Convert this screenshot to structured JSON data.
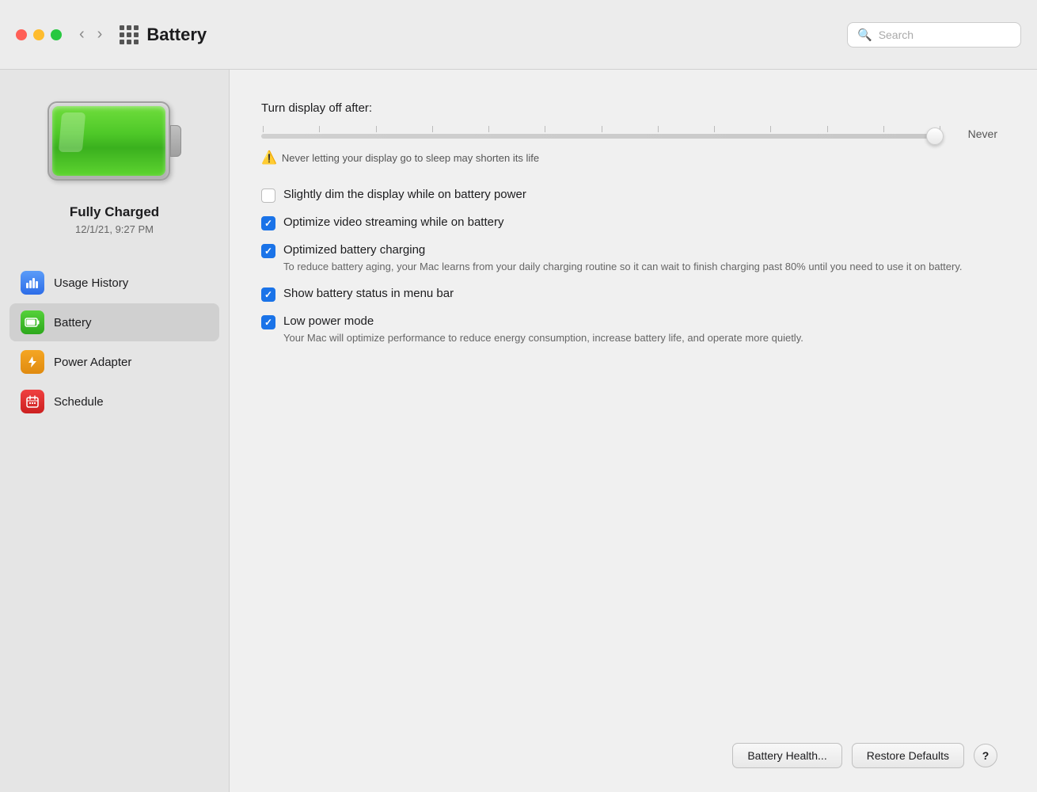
{
  "titlebar": {
    "title": "Battery",
    "search_placeholder": "Search",
    "back_icon": "‹",
    "forward_icon": "›"
  },
  "sidebar": {
    "battery_status": "Fully Charged",
    "battery_time": "12/1/21, 9:27 PM",
    "nav_items": [
      {
        "id": "usage-history",
        "label": "Usage History",
        "icon": "📊",
        "icon_class": "icon-usage",
        "active": false
      },
      {
        "id": "battery",
        "label": "Battery",
        "icon": "🔋",
        "icon_class": "icon-battery",
        "active": true
      },
      {
        "id": "power-adapter",
        "label": "Power Adapter",
        "icon": "⚡",
        "icon_class": "icon-power",
        "active": false
      },
      {
        "id": "schedule",
        "label": "Schedule",
        "icon": "📅",
        "icon_class": "icon-schedule",
        "active": false
      }
    ]
  },
  "settings": {
    "slider_label": "Turn display off after:",
    "slider_value": "Never",
    "slider_warning": "Never letting your display go to sleep may shorten its life",
    "checkboxes": [
      {
        "id": "dim-display",
        "label": "Slightly dim the display while on battery power",
        "checked": false,
        "sub": ""
      },
      {
        "id": "optimize-streaming",
        "label": "Optimize video streaming while on battery",
        "checked": true,
        "sub": ""
      },
      {
        "id": "optimized-charging",
        "label": "Optimized battery charging",
        "checked": true,
        "sub": "To reduce battery aging, your Mac learns from your daily charging routine so it can wait to finish charging past 80% until you need to use it on battery."
      },
      {
        "id": "menu-bar",
        "label": "Show battery status in menu bar",
        "checked": true,
        "sub": ""
      },
      {
        "id": "low-power",
        "label": "Low power mode",
        "checked": true,
        "sub": "Your Mac will optimize performance to reduce energy consumption, increase battery life, and operate more quietly."
      }
    ]
  },
  "buttons": {
    "battery_health": "Battery Health...",
    "restore_defaults": "Restore Defaults",
    "help": "?"
  }
}
